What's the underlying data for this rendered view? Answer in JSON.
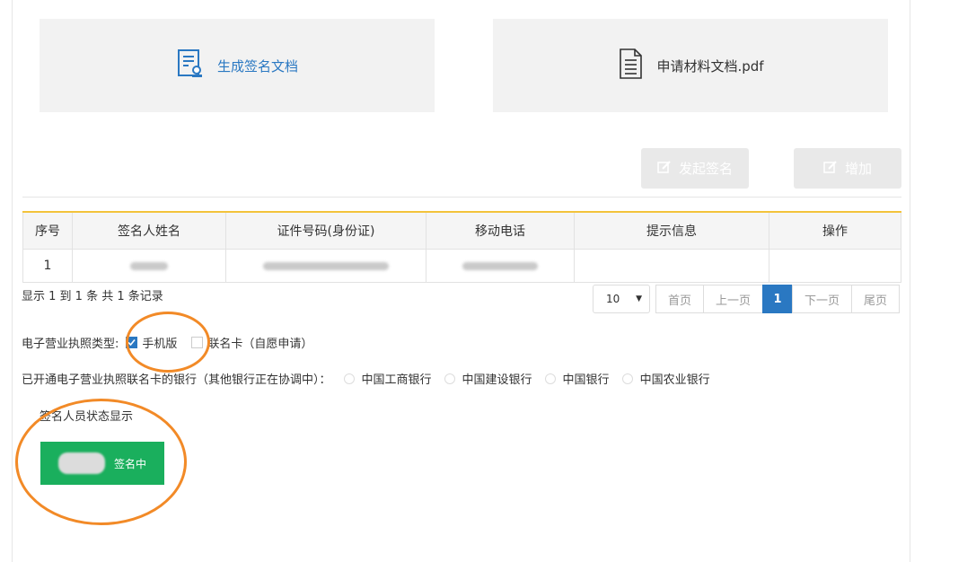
{
  "cards": {
    "generate_label": "生成签名文档",
    "material_label": "申请材料文档.pdf"
  },
  "actions": {
    "start_sign_label": "发起签名",
    "add_label": "增加"
  },
  "table": {
    "headers": [
      "序号",
      "签名人姓名",
      "证件号码(身份证)",
      "移动电话",
      "提示信息",
      "操作"
    ],
    "rows": [
      {
        "index": "1",
        "tip": "",
        "op": ""
      }
    ]
  },
  "summary": "显示 1 到 1 条 共 1 条记录",
  "pager": {
    "page_size": "10",
    "first": "首页",
    "prev": "上一页",
    "current": "1",
    "next": "下一页",
    "last": "尾页"
  },
  "license_type": {
    "label": "电子营业执照类型:",
    "options": [
      {
        "label": "手机版",
        "checked": true
      },
      {
        "label": "联名卡（自愿申请）",
        "checked": false
      }
    ]
  },
  "banks": {
    "label": "已开通电子营业执照联名卡的银行（其他银行正在协调中）：",
    "options": [
      "中国工商银行",
      "中国建设银行",
      "中国银行",
      "中国农业银行"
    ]
  },
  "status": {
    "title": "签名人员状态显示",
    "state_label": "签名中"
  },
  "colors": {
    "accent": "#2a78c2",
    "status_green": "#1aaf5d",
    "annotation_orange": "#f28a27",
    "table_top": "#f3c33b"
  }
}
